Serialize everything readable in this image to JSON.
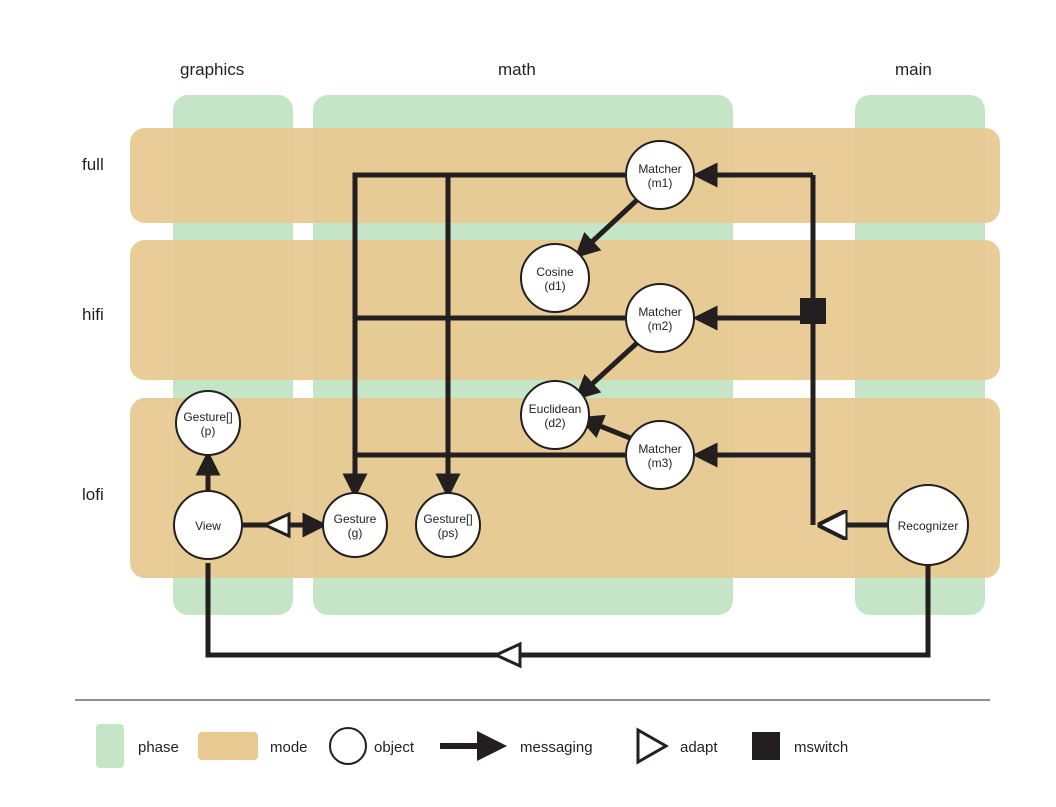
{
  "columns": {
    "graphics": "graphics",
    "math": "math",
    "main": "main"
  },
  "rows": {
    "full": "full",
    "hifi": "hifi",
    "lofi": "lofi"
  },
  "nodes": {
    "gesture_p": {
      "label": "Gesture[]",
      "sub": "(p)"
    },
    "view": {
      "label": "View",
      "sub": ""
    },
    "gesture_g": {
      "label": "Gesture",
      "sub": "(g)"
    },
    "gesture_ps": {
      "label": "Gesture[]",
      "sub": "(ps)"
    },
    "cosine": {
      "label": "Cosine",
      "sub": "(d1)"
    },
    "euclidean": {
      "label": "Euclidean",
      "sub": "(d2)"
    },
    "matcher_m1": {
      "label": "Matcher",
      "sub": "(m1)"
    },
    "matcher_m2": {
      "label": "Matcher",
      "sub": "(m2)"
    },
    "matcher_m3": {
      "label": "Matcher",
      "sub": "(m3)"
    },
    "recognizer": {
      "label": "Recognizer",
      "sub": ""
    }
  },
  "legend": {
    "phase": "phase",
    "mode": "mode",
    "object": "object",
    "messaging": "messaging",
    "adapt": "adapt",
    "mswitch": "mswitch"
  },
  "colors": {
    "phase_green": "#c5e6c6",
    "mode_tan": "#e8c991",
    "node_fill": "#ffffff",
    "node_stroke": "#231f20",
    "line": "#231f20"
  }
}
